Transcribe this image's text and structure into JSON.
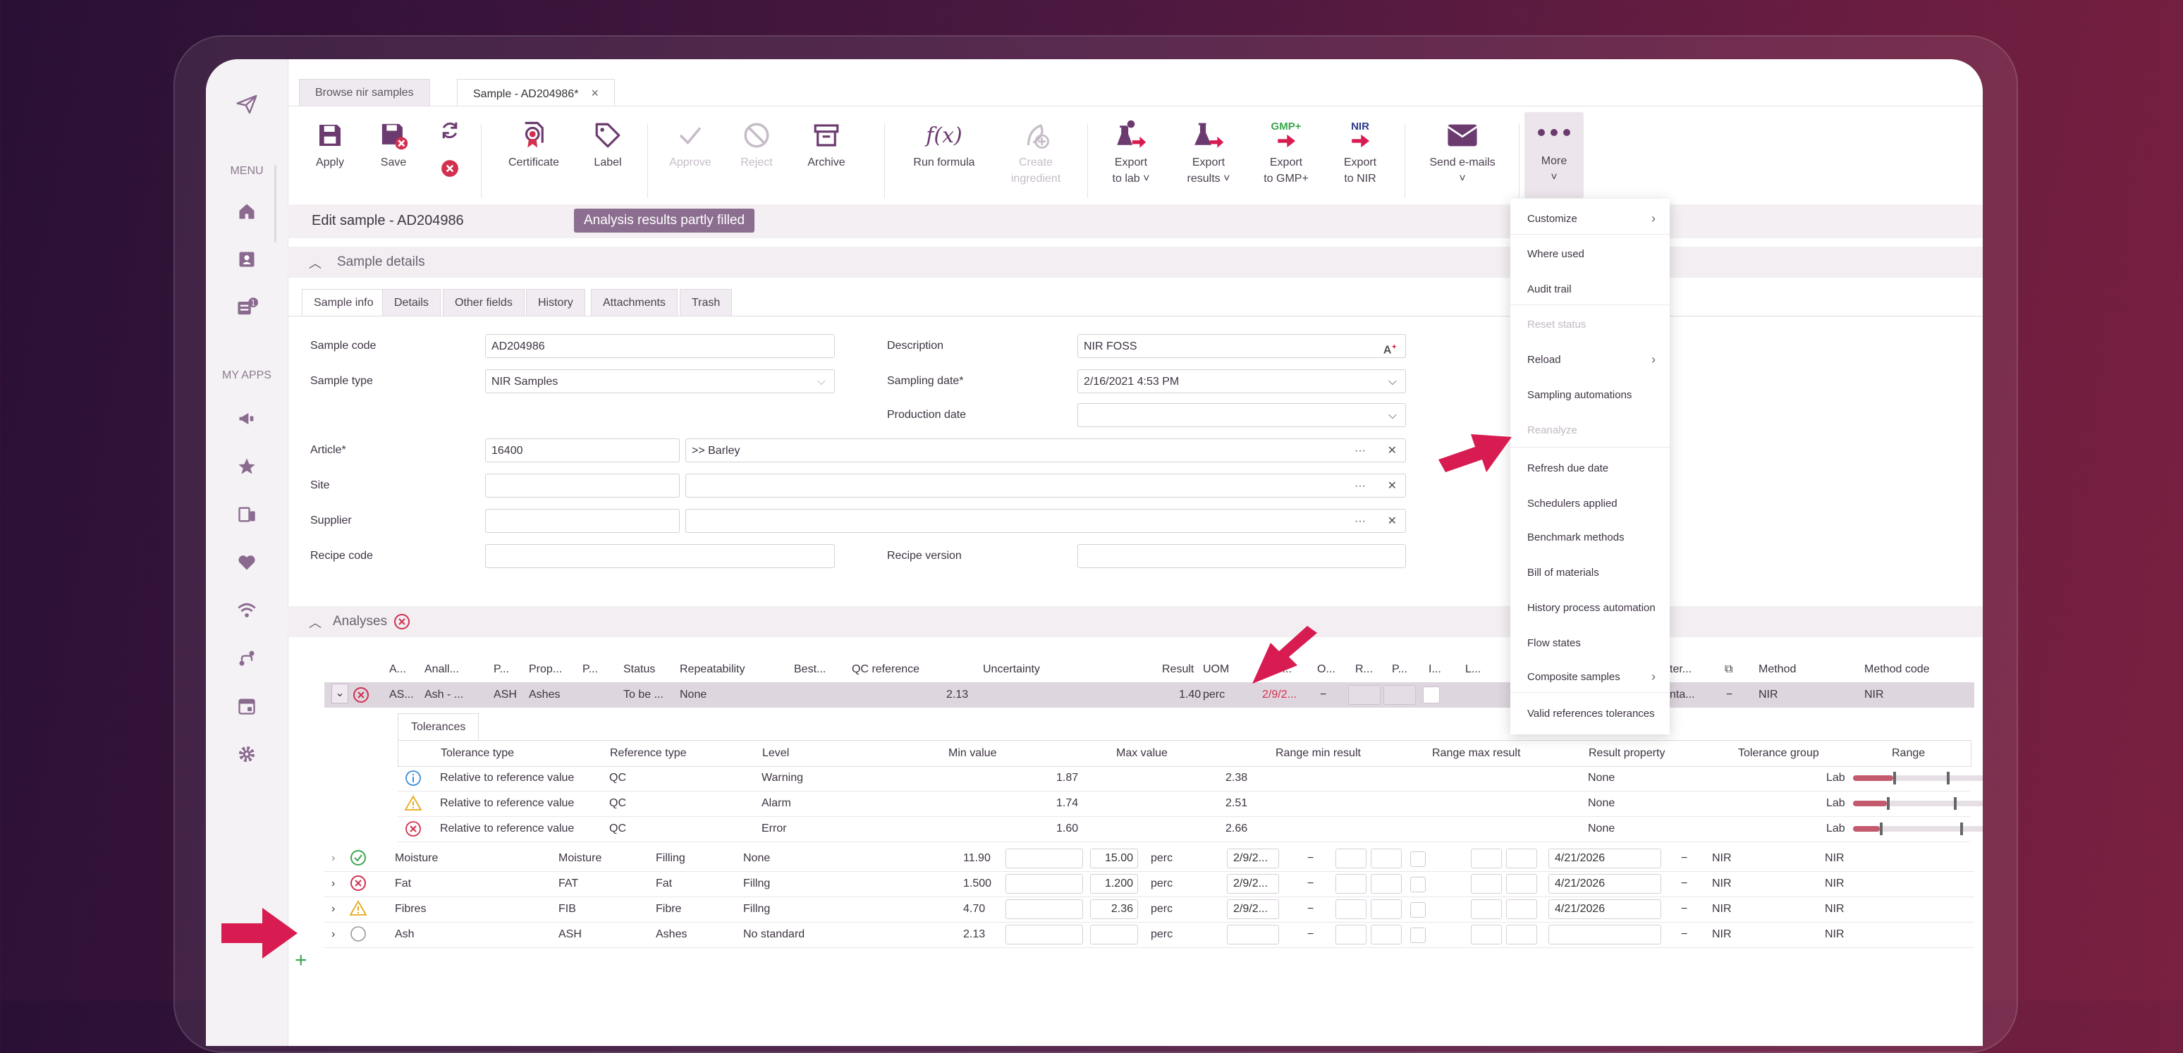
{
  "tabs": [
    {
      "label": "Browse nir samples"
    },
    {
      "label": "Sample - AD204986*",
      "close": "×"
    }
  ],
  "rail": {
    "menu_label": "MENU",
    "apps_label": "MY APPS"
  },
  "toolbar": {
    "apply": "Apply",
    "save": "Save",
    "certificate": "Certificate",
    "label": "Label",
    "approve": "Approve",
    "reject": "Reject",
    "archive": "Archive",
    "run_formula": "Run formula",
    "create_ingredient_1": "Create",
    "create_ingredient_2": "ingredient",
    "export_lab_1": "Export",
    "export_lab_2": "to lab ˅",
    "export_results_1": "Export",
    "export_results_2": "results ˅",
    "export_gmp_1": "Export",
    "export_gmp_2": "to GMP+",
    "export_nir_1": "Export",
    "export_nir_2": "to NIR",
    "send_emails_1": "Send e-mails",
    "send_emails_2": "˅",
    "more_1": "More",
    "more_2": "˅",
    "fx": "f(x)",
    "gmp_tag": "GMP+",
    "nir_tag": "NIR"
  },
  "edit": {
    "title": "Edit sample - AD204986",
    "badge": "Analysis results partly filled"
  },
  "sample_details": {
    "title": "Sample details",
    "subtabs": [
      "Sample info",
      "Details",
      "Other fields",
      "History",
      "Attachments",
      "Trash"
    ],
    "fields": {
      "sample_code_label": "Sample code",
      "sample_code": "AD204986",
      "sample_type_label": "Sample type",
      "sample_type": "NIR Samples",
      "article_label": "Article*",
      "article_code": "16400",
      "article_name": ">> Barley",
      "site_label": "Site",
      "supplier_label": "Supplier",
      "recipe_code_label": "Recipe code",
      "description_label": "Description",
      "description": "NIR FOSS",
      "sampling_date_label": "Sampling date*",
      "sampling_date": "2/16/2021 4:53 PM",
      "production_date_label": "Production date",
      "recipe_version_label": "Recipe version",
      "dots": "···",
      "clear": "✕",
      "dropdown": "⌵"
    }
  },
  "analyses": {
    "title": "Analyses",
    "headers": [
      "A...",
      "Anall...",
      "P...",
      "Prop...",
      "P...",
      "Status",
      "Repeatability",
      "Best...",
      "QC reference",
      "Uncertainty",
      "Result",
      "UOM",
      "Res...",
      "O...",
      "R...",
      "P...",
      "I...",
      "L...",
      "ter...",
      "",
      "Method",
      "Method code"
    ],
    "selected": {
      "a": "AS...",
      "anal": "Ash - ...",
      "p": "ASH",
      "prop": "Ashes",
      "status": "To be ...",
      "repeatability": "None",
      "qc": "2.13",
      "result": "1.40",
      "uom": "perc",
      "res": "2/9/2...",
      "dash": "−",
      "ter": "nta...",
      "dash2": "−",
      "method": "NIR",
      "method_code": "NIR"
    },
    "tolerances_tab": "Tolerances",
    "tol_headers": [
      "Tolerance type",
      "Reference type",
      "Level",
      "Min value",
      "Max value",
      "Range min result",
      "Range max result",
      "Result property",
      "Tolerance group",
      "Range"
    ],
    "tol_rows": [
      {
        "type": "Relative to reference value",
        "ref": "QC",
        "level": "Warning",
        "min": "1.87",
        "max": "2.38",
        "prop": "None",
        "group": "Lab",
        "icon": "info",
        "range": [
          0.3,
          0.7
        ]
      },
      {
        "type": "Relative to reference value",
        "ref": "QC",
        "level": "Alarm",
        "min": "1.74",
        "max": "2.51",
        "prop": "None",
        "group": "Lab",
        "icon": "warning",
        "range": [
          0.25,
          0.75
        ]
      },
      {
        "type": "Relative to reference value",
        "ref": "QC",
        "level": "Error",
        "min": "1.60",
        "max": "2.66",
        "prop": "None",
        "group": "Lab",
        "icon": "error",
        "range": [
          0.2,
          0.8
        ]
      }
    ],
    "rows": [
      {
        "name": "Moisture",
        "code": "Moisture",
        "prop": "Filling",
        "std": "None",
        "val": "11.90",
        "box2": "15.00",
        "uom": "perc",
        "res": "2/9/2...",
        "date": "4/21/2026",
        "method": "NIR",
        "code2": "NIR",
        "icon": "ok"
      },
      {
        "name": "Fat",
        "code": "FAT",
        "prop": "Fat",
        "std": "Fillng",
        "val": "1.500",
        "box2": "1.200",
        "uom": "perc",
        "res": "2/9/2...",
        "date": "4/21/2026",
        "method": "NIR",
        "code2": "NIR",
        "icon": "error"
      },
      {
        "name": "Fibres",
        "code": "FIB",
        "prop": "Fibre",
        "std": "Fillng",
        "val": "4.70",
        "box2": "2.36",
        "uom": "perc",
        "res": "2/9/2...",
        "date": "4/21/2026",
        "method": "NIR",
        "code2": "NIR",
        "icon": "warning"
      },
      {
        "name": "Ash",
        "code": "ASH",
        "prop": "Ashes",
        "std": "No standard",
        "val": "2.13",
        "box2": "",
        "uom": "perc",
        "res": "",
        "date": "",
        "method": "NIR",
        "code2": "NIR",
        "icon": "empty"
      }
    ],
    "add": "+"
  },
  "more_menu": {
    "items": [
      {
        "label": "Customize",
        "arrow": "›",
        "disabled": false
      },
      {
        "label": "Where used",
        "disabled": false
      },
      {
        "label": "Audit trail",
        "disabled": false
      },
      {
        "label": "Reset status",
        "disabled": true
      },
      {
        "label": "Reload",
        "arrow": "›",
        "disabled": false
      },
      {
        "label": "Sampling automations",
        "disabled": false
      },
      {
        "label": "Reanalyze",
        "disabled": true
      },
      {
        "label": "Refresh due date",
        "disabled": false
      },
      {
        "label": "Schedulers applied",
        "disabled": false
      },
      {
        "label": "Benchmark methods",
        "disabled": false
      },
      {
        "label": "Bill of materials",
        "disabled": false
      },
      {
        "label": "History process automation",
        "disabled": false
      },
      {
        "label": "Flow states",
        "disabled": false
      },
      {
        "label": "Composite samples",
        "arrow": "›",
        "disabled": false
      },
      {
        "label": "Valid references tolerances",
        "disabled": false
      }
    ]
  },
  "colors": {
    "accent": "#8c6f90",
    "arrow": "#d81b50",
    "error": "#d32f4f",
    "ok": "#3aa64f",
    "warning": "#e6a817",
    "info": "#3b8ed8"
  }
}
